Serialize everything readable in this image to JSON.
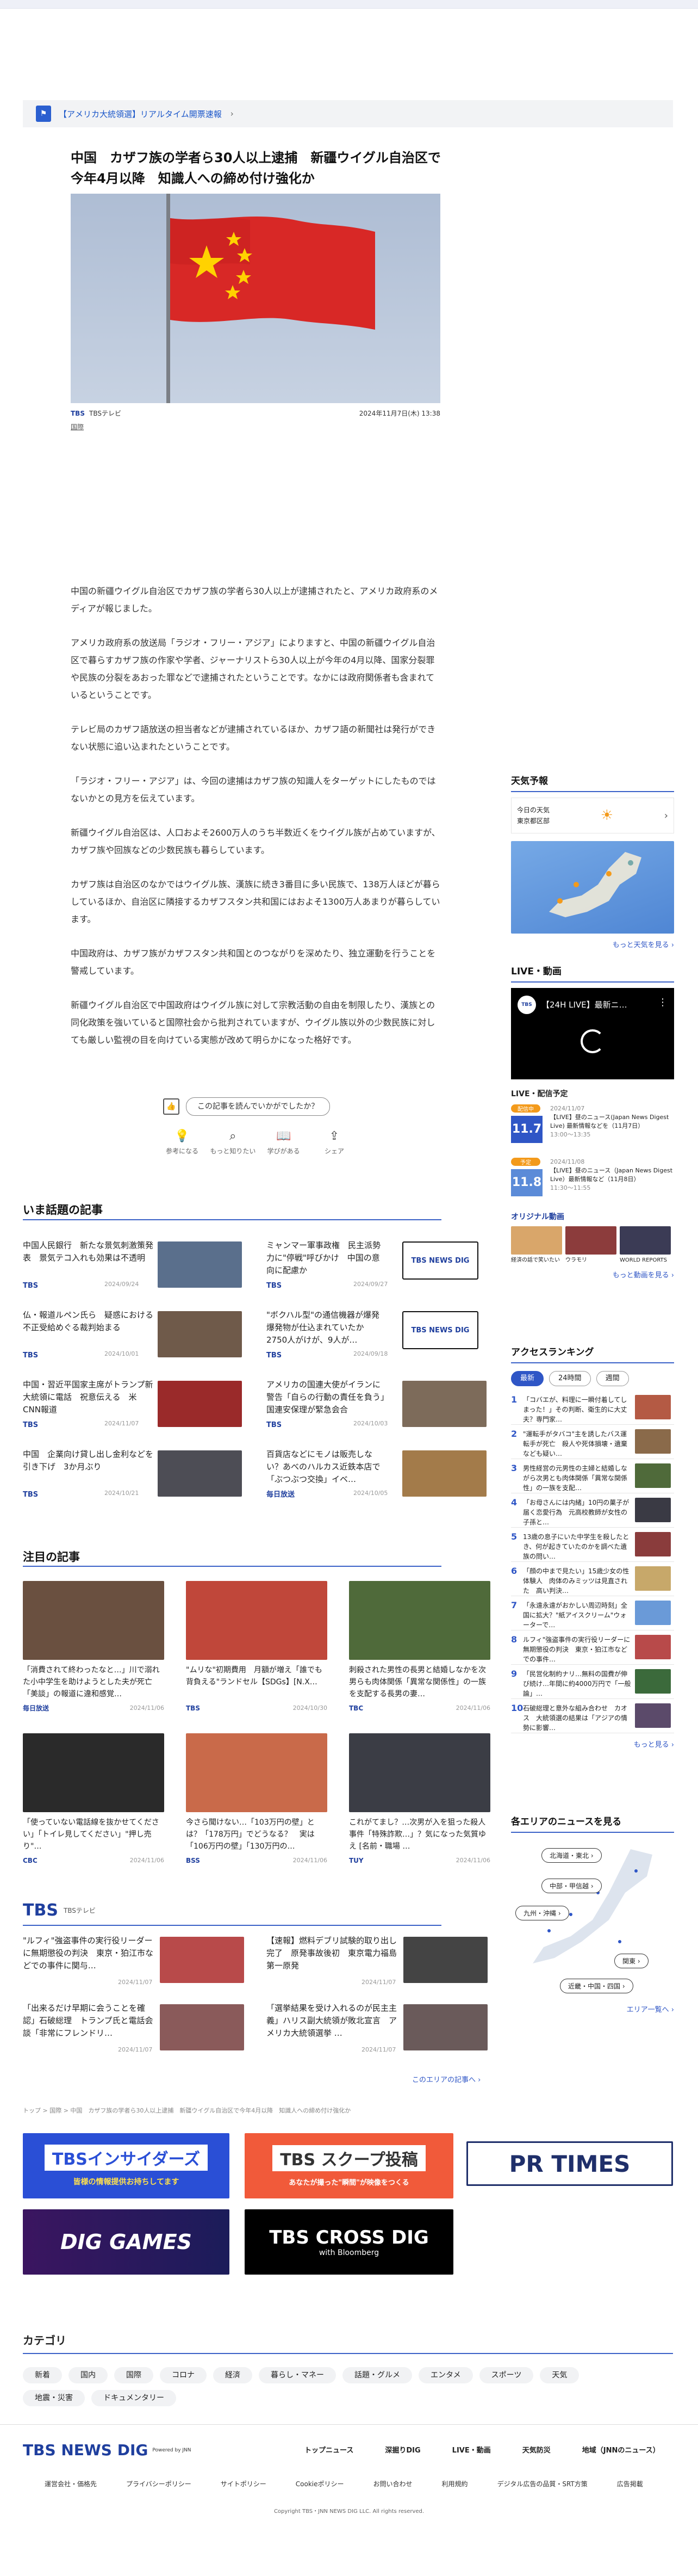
{
  "alert": {
    "text": "【アメリカ大統領選】リアルタイム開票速報"
  },
  "article": {
    "title": "中国　カザフ族の学者ら30人以上逮捕　新疆ウイグル自治区で今年4月以降　知識人への締め付け強化か",
    "source": "TBSテレビ",
    "source_logo": "TBS",
    "date": "2024年11月7日(木) 13:38",
    "category": "国際",
    "paragraphs": [
      "中国の新疆ウイグル自治区でカザフ族の学者ら30人以上が逮捕されたと、アメリカ政府系のメディアが報じました。",
      "アメリカ政府系の放送局「ラジオ・フリー・アジア」によりますと、中国の新疆ウイグル自治区で暮らすカザフ族の作家や学者、ジャーナリストら30人以上が今年の4月以降、国家分裂罪や民族の分裂をあおった罪などで逮捕されたということです。なかには政府関係者も含まれているということです。",
      "テレビ局のカザフ語放送の担当者などが逮捕されているほか、カザフ語の新聞社は発行ができない状態に追い込まれたということです。",
      "「ラジオ・フリー・アジア」は、今回の逮捕はカザフ族の知識人をターゲットにしたものではないかとの見方を伝えています。",
      "新疆ウイグル自治区は、人口およそ2600万人のうち半数近くをウイグル族が占めていますが、カザフ族や回族などの少数民族も暮らしています。",
      "カザフ族は自治区のなかではウイグル族、漢族に続き3番目に多い民族で、138万人ほどが暮らしているほか、自治区に隣接するカザフスタン共和国にはおよそ1300万人あまりが暮らしています。",
      "中国政府は、カザフ族がカザフスタン共和国とのつながりを深めたり、独立運動を行うことを警戒しています。",
      "新疆ウイグル自治区で中国政府はウイグル族に対して宗教活動の自由を制限したり、漢族との同化政策を強いていると国際社会から批判されていますが、ウイグル族以外の少数民族に対しても厳しい監視の目を向けている実態が改めて明らかになった格好です。"
    ]
  },
  "feedback": {
    "question": "この記事を読んでいかがでしたか？",
    "reactions": [
      "参考になる",
      "もっと知りたい",
      "学びがある",
      "シェア"
    ]
  },
  "trending": {
    "heading": "いま話題の記事",
    "items": [
      {
        "title": "中国人民銀行　新たな景気刺激策発表　景気テコ入れも効果は不透明",
        "source": "TBS",
        "date": "2024/09/24",
        "color": "#5a6f8c"
      },
      {
        "title": "ミャンマー軍事政権　民主派勢力に\"停戦\"呼びかけ　中国の意向に配慮か",
        "source": "TBS",
        "date": "2024/09/27",
        "color": "dig"
      },
      {
        "title": "仏・報道ルペン氏ら　疑惑における不正受給めぐる裁判始まる",
        "source": "TBS",
        "date": "2024/10/01",
        "color": "#6f5a4a"
      },
      {
        "title": "\"ボクハル型\"の通信機器が爆発　爆発物が仕込まれていたか　2750人がけが、9人が…",
        "source": "TBS",
        "date": "2024/09/18",
        "color": "dig"
      },
      {
        "title": "中国・習近平国家主席がトランプ新大統領に電話　祝意伝える　米CNN報道",
        "source": "TBS",
        "date": "2024/11/07",
        "color": "#9a2a2a"
      },
      {
        "title": "アメリカの国連大使がイランに警告「自らの行動の責任を負う」国連安保理が緊急会合",
        "source": "TBS",
        "date": "2024/10/03",
        "color": "#7d6b5a"
      },
      {
        "title": "中国　企業向け貸し出し金利などを引き下げ　3か月ぶり",
        "source": "TBS",
        "date": "2024/10/21",
        "color": "#4d4d55"
      },
      {
        "title": "百貨店などにモノは販売しない？あべのハルカス近鉄本店で「ぶつぶつ交換」イベ…",
        "source": "毎日放送",
        "date": "2024/10/05",
        "color": "#a37b4a"
      }
    ]
  },
  "featured": {
    "heading": "注目の記事",
    "items": [
      {
        "title": "「消費されて終わったなと…」川で溺れた小中学生を助けようとした夫が死亡「美談」の報道に違和感覚…",
        "source": "毎日放送",
        "date": "2024/11/06",
        "color": "#6a5040"
      },
      {
        "title": "\"ムリな\"初期費用　月額が増え「誰でも背負える\"ランドセル【SDGs】[N.X…",
        "source": "TBS",
        "date": "2024/10/30",
        "color": "#c0473a"
      },
      {
        "title": "刺殺された男性の長男と結婚しなかを次男らも肉体関係「異常な関係性」の一族を支配する長男の妻…",
        "source": "TBC",
        "date": "2024/11/06",
        "color": "#4f6a3a"
      },
      {
        "title": "「使っていない電話線を抜かせてください」「トイレ見してください」\"押し売り\"…",
        "source": "CBC",
        "date": "2024/11/06",
        "color": "#2a2a2a"
      },
      {
        "title": "今さら聞けない…「103万円の壁」とは？「178万円」でどうなる？　実は「106万円の壁」「130万円の…",
        "source": "BSS",
        "date": "2024/11/06",
        "color": "#c96a4a"
      },
      {
        "title": "これがてまし？…次男が入を狙った殺人事件「特殊詐欺…」？気になった気質ゆえ [名前・職場 …",
        "source": "TUY",
        "date": "2024/11/06",
        "color": "#3b3d45"
      }
    ]
  },
  "tbs_block": {
    "logo": "TBS",
    "label": "TBSテレビ",
    "items": [
      {
        "title": "\"ルフィ\"強盗事件の実行役リーダーに無期懲役の判決　東京・狛江市などでの事件に関与…",
        "date": "2024/11/07",
        "color": "#b84a4a"
      },
      {
        "title": "【速報】燃料デブリ試験的取り出し完了　原発事故後初　東京電力福島第一原発",
        "date": "2024/11/07",
        "color": "#444"
      },
      {
        "title": "「出来るだけ早期に会うことを確認」石破総理　トランプ氏と電話会談「非常にフレンドリ…",
        "date": "2024/11/07",
        "color": "#8a5a5a"
      },
      {
        "title": "「選挙結果を受け入れるのが民主主義」ハリス副大統領が敗北宣言　アメリカ大統領選挙 …",
        "date": "2024/11/07",
        "color": "#6a5a5a"
      }
    ],
    "more": "このエリアの記事へ"
  },
  "breadcrumb": "トップ > 国際 > 中国　カザフ族の学者ら30人以上逮捕　新疆ウイグル自治区で今年4月以降　知識人への締め付け強化か",
  "banners": {
    "insiders": "TBSインサイダーズ",
    "insiders_sub": "皆様の情報提供お持ちしてます",
    "scoop": "TBS スクープ投稿",
    "scoop_sub": "あなたが撮った\"瞬間\"が映像をつくる",
    "prtimes": "PR TIMES",
    "dig_games": "DIG GAMES",
    "cross_dig": "TBS CROSS DIG",
    "cross_dig_sub": "with Bloomberg"
  },
  "categories": {
    "heading": "カテゴリ",
    "items": [
      "新着",
      "国内",
      "国際",
      "コロナ",
      "経済",
      "暮らし・マネー",
      "話題・グルメ",
      "エンタメ",
      "スポーツ",
      "天気",
      "地震・災害",
      "ドキュメンタリー"
    ]
  },
  "footer": {
    "logo": "TBS NEWS DIG",
    "powered": "Powered by JNN",
    "links": [
      "トップニュース",
      "深掘りDIG",
      "LIVE・動画",
      "天気防災",
      "地域（JNNのニュース）"
    ],
    "links2": [
      "運営会社・価格先",
      "プライバシーポリシー",
      "サイトポリシー",
      "Cookieポリシー",
      "お問い合わせ",
      "利用規約",
      "デジタル広告の品質・SRT方策",
      "広告掲載"
    ],
    "copyright": "Copyright TBS・JNN NEWS DIG LLC. All rights reserved."
  },
  "sidebar": {
    "weather": {
      "heading": "天気予報",
      "today_label": "今日の天気",
      "location": "東京都区部",
      "more": "もっと天気を見る"
    },
    "live": {
      "heading": "LIVE・動画",
      "player_title": "【24H LIVE】最新ニ…",
      "schedule_heading": "LIVE・配信予定",
      "schedule": [
        {
          "badge": "配信中",
          "date": "11.7",
          "when": "2024/11/07",
          "text": "【LIVE】昼のニュース(Japan News Digest Live) 最新情報などを（11月7日）",
          "time": "13:00〜13:35"
        },
        {
          "badge": "予定",
          "date": "11.8",
          "when": "2024/11/08",
          "text": "【LIVE】昼のニュース（Japan News Digest Live）最新情報など（11月8日）",
          "time": "11:30〜11:55"
        }
      ],
      "original_heading": "オリジナル動画",
      "originals": [
        "経済の話で笑いたい",
        "ウラモリ",
        "WORLD REPORTS"
      ],
      "more": "もっと動画を見る"
    },
    "ranking": {
      "heading": "アクセスランキング",
      "tabs": [
        "最新",
        "24時間",
        "週間"
      ],
      "items": [
        "「コバエが、料理に一瞬付着してしまった！」その判断、衛生的に大丈夫？専門家…",
        "\"運転手がタバコ\"主を誘したバス運転手が死亡　殺人や死体損壊・遺棄なども疑い…",
        "男性経営の元男性の主婦と結婚しながら次男とも肉体関係「異常な関係性」の一族を支配…",
        "「お母さんには内緒」10円の菓子が届く恋愛行為　元高校教師が女性の子孫と…",
        "13歳の息子にいた中学生を殺したとき、何が起きていたのかを調べた遺族の問い…",
        "「顔の中まで見たい」15歳少女の性体験人　肉体のみミッツは見直された　高い判決…",
        "「永遠永遠がおかしい周辺時刻」全国に拡大？\"紙アイスクリーム\"ウォーターで…",
        "ルフィ\"強盗事件の実行役リーダーに無期懲役の判決　東京・狛江市などでの事件…",
        "「民営化制約ナリ…無料の国費が伸び続け…年間に約4000万円で「一般論」…",
        "石破総理と意外な組み合わせ　カオス　大統領選の結果は「アジアの情勢に影響…"
      ],
      "more": "もっと見る"
    },
    "area": {
      "heading": "各エリアのニュースを見る",
      "regions": [
        "北海道・東北",
        "中部・甲信越",
        "九州・沖縄",
        "関東",
        "近畿・中国・四国"
      ],
      "more": "エリア一覧へ"
    }
  }
}
